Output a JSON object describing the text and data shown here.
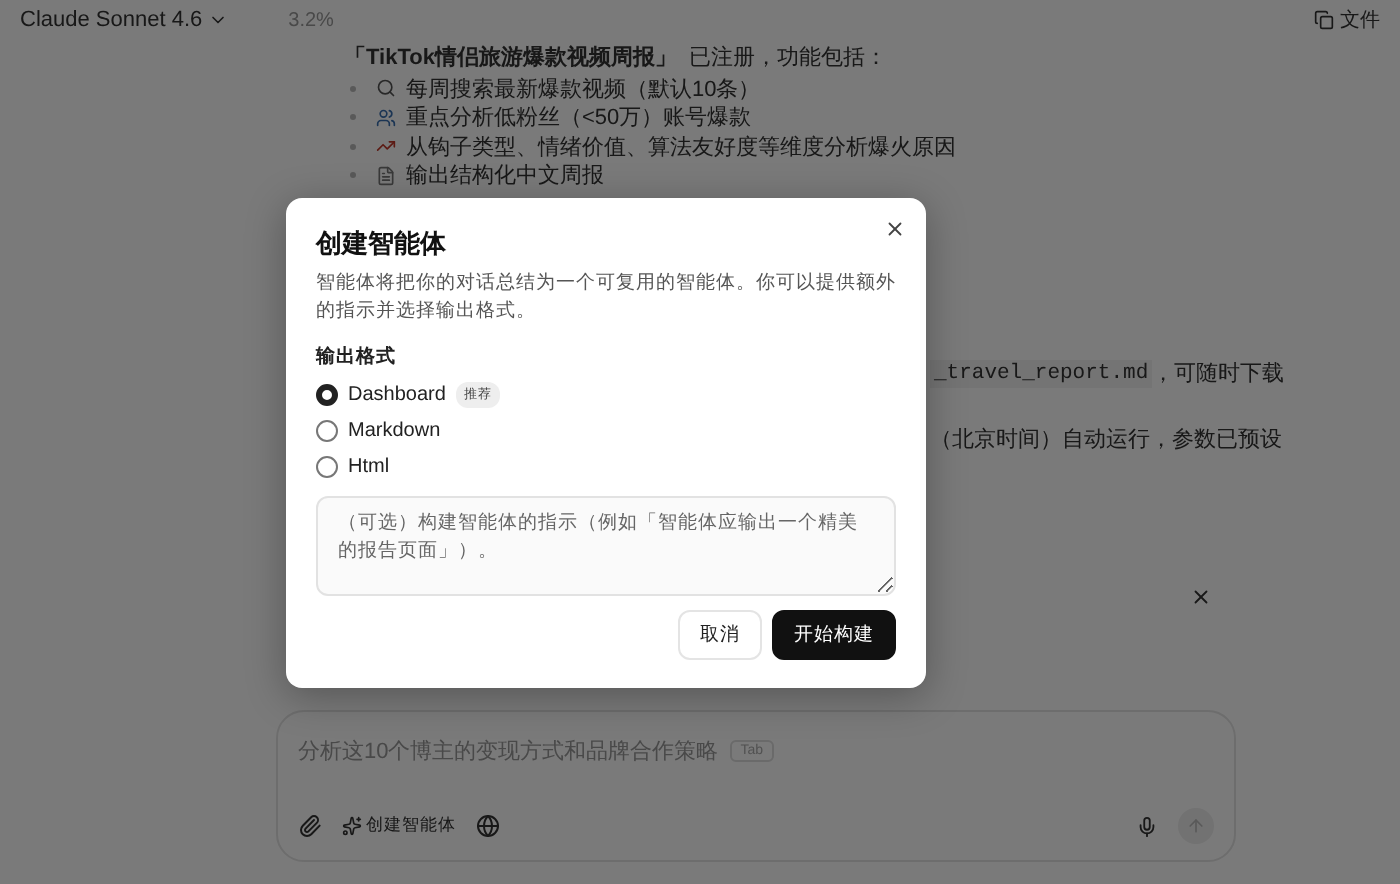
{
  "header": {
    "model": "Claude Sonnet 4.6",
    "usage": "3.2%",
    "files_button": "文件"
  },
  "chat": {
    "intro_title": "「TikTok情侣旅游爆款视频周报」",
    "intro_rest": "已注册，功能包括：",
    "features": [
      "每周搜索最新爆款视频（默认10条）",
      "重点分析低粉丝（<50万）账号爆款",
      "从钩子类型、情绪价值、算法友好度等维度分析爆火原因",
      "输出结构化中文周报"
    ],
    "report_file": "_travel_report.md",
    "report_note": "，可随时下载",
    "schedule_note": "（北京时间）自动运行，参数已预设"
  },
  "composer": {
    "suggestion": "分析这10个博主的变现方式和品牌合作策略",
    "tab_hint": "Tab",
    "agent_button": "创建智能体"
  },
  "dialog": {
    "title": "创建智能体",
    "description": "智能体将把你的对话总结为一个可复用的智能体。你可以提供额外的指示并选择输出格式。",
    "format_label": "输出格式",
    "formats": [
      {
        "label": "Dashboard",
        "badge": "推荐",
        "selected": true
      },
      {
        "label": "Markdown",
        "selected": false
      },
      {
        "label": "Html",
        "selected": false
      }
    ],
    "instructions_placeholder": "（可选）构建智能体的指示（例如「智能体应输出一个精美的报告页面」）。",
    "buttons": [
      {
        "label": "取消",
        "kind": "secondary"
      },
      {
        "label": "开始构建",
        "kind": "primary"
      }
    ]
  }
}
